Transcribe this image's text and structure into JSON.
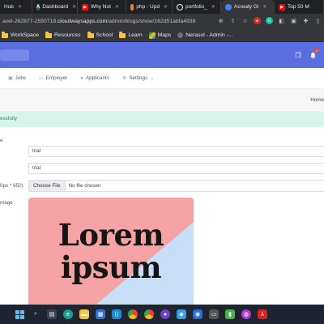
{
  "browser": {
    "tabs": [
      {
        "label": "Hub",
        "favicon_color": "#24292f",
        "favicon_glyph": ""
      },
      {
        "label": "Dashboard",
        "favicon_color": "#2f5f4f",
        "favicon_glyph": "A"
      },
      {
        "label": "Why Not",
        "favicon_color": "#ff0000",
        "favicon_glyph": "▶"
      },
      {
        "label": "php - Upd",
        "favicon_color": "#f48024",
        "favicon_glyph": ""
      },
      {
        "label": "portfolio_",
        "favicon_color": "#24292f",
        "favicon_glyph": ""
      },
      {
        "label": "Acreaty Gl",
        "favicon_color": "#4285f4",
        "favicon_glyph": ""
      },
      {
        "label": "Top 50 M",
        "favicon_color": "#ff0000",
        "favicon_glyph": "▶"
      }
    ],
    "url_prefix": "avel-262877-2550718.",
    "url_host": "cloudwaysapps.com",
    "url_path": "/admin/blogs/show/162d51abfa4939",
    "bookmarks": [
      {
        "label": "WorkSpace",
        "icon": "folder-icon"
      },
      {
        "label": "Resources",
        "icon": "folder-icon"
      },
      {
        "label": "School",
        "icon": "folder-icon"
      },
      {
        "label": "Learn",
        "icon": "folder-icon"
      },
      {
        "label": "Maps",
        "icon": "maps-icon"
      },
      {
        "label": "Nerasol - Admin -...",
        "icon": "nerasol-icon"
      }
    ]
  },
  "app": {
    "header_color": "#5b6ee1",
    "notification_count": "1",
    "nav": [
      {
        "label": "Jobs",
        "icon": "briefcase-icon"
      },
      {
        "label": "Employer",
        "icon": "employer-icon"
      },
      {
        "label": "Applicants",
        "icon": "user-icon"
      },
      {
        "label": "Settings",
        "icon": "gear-icon"
      }
    ],
    "breadcrumb": "Home",
    "alert": "essfully"
  },
  "form": {
    "label_1": "e",
    "input_1": "trial",
    "input_2": "trial",
    "label_file": "0px * 650)",
    "choose_file": "Choose File",
    "no_file": "No file chosen",
    "label_image": "mage",
    "preview_line1": "Lorem",
    "preview_line2": "ipsum"
  },
  "colors": {
    "alert_bg": "#d8f5ea",
    "preview_pink": "#f6a3a6",
    "preview_blue": "#c6def6"
  }
}
